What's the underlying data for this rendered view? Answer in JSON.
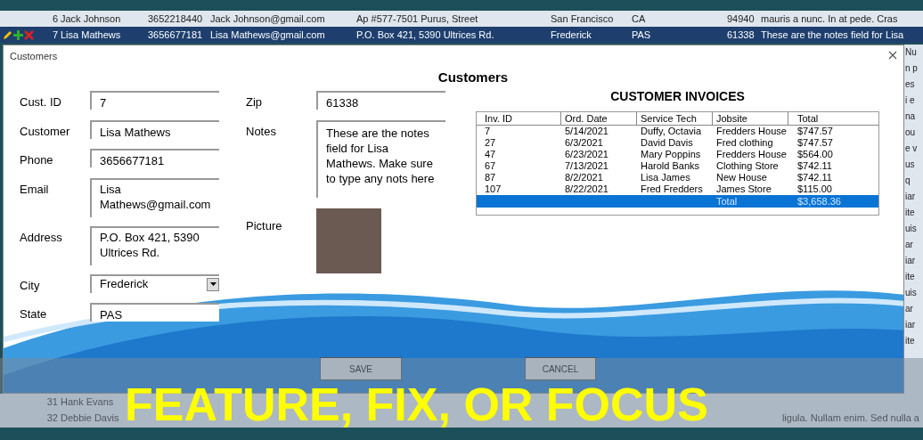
{
  "grid_rows": [
    {
      "selected": false,
      "cells": [
        "6",
        "Jack Johnson",
        "3652218440",
        "Jack Johnson@gmail.com",
        "Ap #577-7501 Purus, Street",
        "San Francisco",
        "CA",
        "94940",
        "mauris a nunc. In at pede. Cras"
      ]
    },
    {
      "selected": true,
      "cells": [
        "7",
        "Lisa Mathews",
        "3656677181",
        "Lisa Mathews@gmail.com",
        "P.O. Box 421, 5390 Ultrices Rd.",
        "Frederick",
        "PAS",
        "61338",
        "These are the notes field for Lisa"
      ]
    }
  ],
  "bottom_rows": [
    {
      "cells": [
        "31",
        "Hank Evans"
      ]
    },
    {
      "cells": [
        "32",
        "Debbie Davis",
        "ligula. Nullam enim. Sed nulla a"
      ]
    }
  ],
  "right_edge_text": [
    "Nu",
    "n p",
    "es",
    "i e",
    "na",
    "ou",
    "e v",
    "us",
    "q",
    "iar",
    "ite",
    "uis",
    "ar",
    "iar",
    "ite",
    "uis",
    "ar",
    "iar",
    "ite"
  ],
  "window": {
    "title": "Customers",
    "heading": "Customers"
  },
  "form_left": [
    {
      "label": "Cust. ID",
      "value": "7",
      "kind": "text"
    },
    {
      "label": "Customer",
      "value": "Lisa Mathews",
      "kind": "text"
    },
    {
      "label": "Phone",
      "value": "3656677181",
      "kind": "text"
    },
    {
      "label": "Email",
      "value": "Lisa Mathews@gmail.com",
      "kind": "multiline"
    },
    {
      "label": "Address",
      "value": "P.O. Box 421, 5390 Ultrices Rd.",
      "kind": "multiline"
    },
    {
      "label": "City",
      "value": "Frederick",
      "kind": "dropdown"
    },
    {
      "label": "State",
      "value": "PAS",
      "kind": "text"
    }
  ],
  "form_right": {
    "zip": {
      "label": "Zip",
      "value": "61338"
    },
    "notes": {
      "label": "Notes",
      "value": "These are the notes field for Lisa Mathews. Make sure to type any nots here"
    },
    "picture": {
      "label": "Picture"
    }
  },
  "invoices": {
    "title": "CUSTOMER INVOICES",
    "columns": [
      "Inv. ID",
      "Ord. Date",
      "Service Tech",
      "Jobsite",
      "Total"
    ],
    "rows": [
      [
        "7",
        "5/14/2021",
        "Duffy, Octavia",
        "Fredders House",
        "$747.57"
      ],
      [
        "27",
        "6/3/2021",
        "David Davis",
        "Fred clothing",
        "$747.57"
      ],
      [
        "47",
        "6/23/2021",
        "Mary Poppins",
        "Fredders House",
        "$564.00"
      ],
      [
        "67",
        "7/13/2021",
        "Harold Banks",
        "Clothing Store",
        "$742.11"
      ],
      [
        "87",
        "8/2/2021",
        "Lisa James",
        "New House",
        "$742.11"
      ],
      [
        "107",
        "8/22/2021",
        "Fred Fredders",
        "James Store",
        "$115.00"
      ]
    ],
    "total_label": "Total",
    "total_value": "$3,658.36"
  },
  "buttons": [
    "SAVE",
    "CANCEL"
  ],
  "banner": "FEATURE, FIX, OR FOCUS"
}
